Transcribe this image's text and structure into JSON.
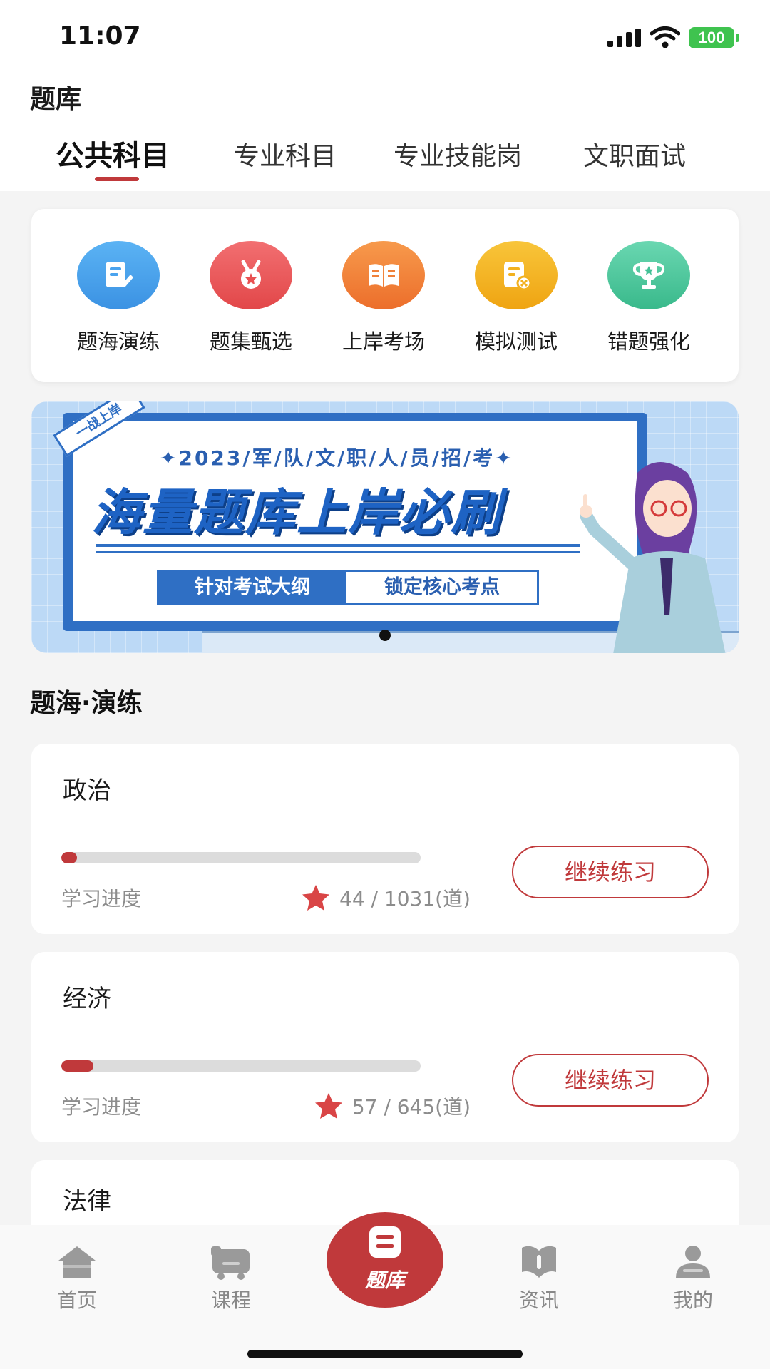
{
  "status_bar": {
    "time": "11:07",
    "battery": "100"
  },
  "header": {
    "title": "题库",
    "tabs": [
      "公共科目",
      "专业科目",
      "专业技能岗",
      "文职面试"
    ],
    "active_tab": 0
  },
  "features": [
    {
      "label": "题海演练",
      "icon": "edit-note-icon",
      "color": "#3f9ce8"
    },
    {
      "label": "题集甄选",
      "icon": "medal-icon",
      "color": "#ea5456"
    },
    {
      "label": "上岸考场",
      "icon": "open-book-icon",
      "color": "#ef7d35"
    },
    {
      "label": "模拟测试",
      "icon": "test-paper-icon",
      "color": "#f3b11c"
    },
    {
      "label": "错题强化",
      "icon": "trophy-icon",
      "color": "#45c49a"
    }
  ],
  "banner": {
    "ribbon": "一战上岸",
    "subtitle": "✦2023/军/队/文/职/人/员/招/考✦",
    "headline": "海量题库上岸必刷",
    "tag1": "针对考试大纲",
    "tag2": "锁定核心考点"
  },
  "section": {
    "title": "题海·演练"
  },
  "subjects": [
    {
      "name": "政治",
      "progress_label": "学习进度",
      "done": "44",
      "total": "1031",
      "count_text": "44 / 1031(道)",
      "button": "继续练习"
    },
    {
      "name": "经济",
      "progress_label": "学习进度",
      "done": "57",
      "total": "645",
      "count_text": "57 / 645(道)",
      "button": "继续练习"
    },
    {
      "name": "法律"
    }
  ],
  "nav": {
    "items": [
      {
        "label": "首页",
        "icon": "home-icon"
      },
      {
        "label": "课程",
        "icon": "course-icon"
      },
      {
        "label": "题库",
        "icon": "question-bank-icon",
        "active": true
      },
      {
        "label": "资讯",
        "icon": "news-icon"
      },
      {
        "label": "我的",
        "icon": "profile-icon"
      }
    ]
  },
  "colors": {
    "accent": "#c0393b",
    "banner_blue": "#2f6fc4"
  }
}
